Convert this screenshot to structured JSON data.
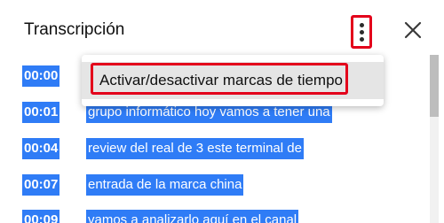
{
  "header": {
    "title": "Transcripción",
    "more_icon": "more-vert-icon",
    "close_icon": "close-icon"
  },
  "menu": {
    "items": [
      {
        "label": "Activar/desactivar marcas de tiempo"
      }
    ]
  },
  "transcript": {
    "segments": [
      {
        "time": "00:00",
        "text": ""
      },
      {
        "time": "00:01",
        "text": "grupo informático hoy vamos a tener una"
      },
      {
        "time": "00:04",
        "text": "review del real de 3 este terminal de"
      },
      {
        "time": "00:07",
        "text": "entrada de la marca china"
      },
      {
        "time": "00:09",
        "text": "vamos a analizarlo aquí en el canal"
      }
    ]
  },
  "colors": {
    "selection": "#2f7cf6",
    "highlight_border": "#e3001b"
  }
}
